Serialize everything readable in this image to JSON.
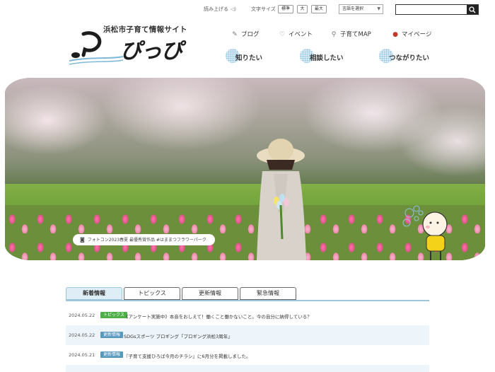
{
  "utility": {
    "read_aloud": "読み上げる",
    "font_size_label": "文字サイズ",
    "font_sizes": [
      "標準",
      "大",
      "最大"
    ],
    "language_label": "言語を選択",
    "search_placeholder": ""
  },
  "logo": {
    "site_name": "浜松市子育て情報サイト",
    "wordmark": "ぴっぴ"
  },
  "nav": {
    "primary": [
      {
        "label": "ブログ",
        "icon": "blog-icon"
      },
      {
        "label": "イベント",
        "icon": "event-icon"
      },
      {
        "label": "子育てMAP",
        "icon": "map-icon"
      },
      {
        "label": "マイページ",
        "icon": "mypage-icon"
      }
    ],
    "secondary": [
      "知りたい",
      "相談したい",
      "つながりたい"
    ]
  },
  "hero": {
    "caption": "フォトコン2023春夏 最優秀賞作品 #はままつフラワーパーク"
  },
  "news": {
    "tabs": [
      "新着情報",
      "トピックス",
      "更新情報",
      "緊急情報"
    ],
    "active_tab": 0,
    "items": [
      {
        "date": "2024.05.22",
        "category": "トピックス",
        "category_type": "topics",
        "title": "《アンケート実施中》本音をおしえて！働くこと働かないこと。今の自分に納得している？"
      },
      {
        "date": "2024.05.22",
        "category": "更新情報",
        "category_type": "update",
        "title": "SDGsスポーツ プロギング「プロギング浜松3周年」"
      },
      {
        "date": "2024.05.21",
        "category": "更新情報",
        "category_type": "update",
        "title": "『子育て支援ひろば今月のチラシ』に6月分を掲載しました。"
      }
    ]
  },
  "colors": {
    "accent_blue": "#9cc5dc",
    "topics_green": "#4fb04a",
    "update_blue": "#5798bd"
  }
}
